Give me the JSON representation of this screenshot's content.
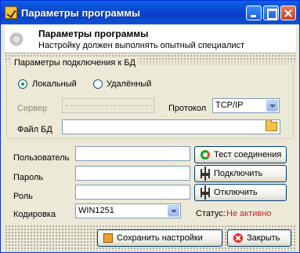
{
  "window": {
    "title": "Параметры программы"
  },
  "header": {
    "title": "Параметры программы",
    "subtitle": "Настройку должен выполнять опытный специалист"
  },
  "connection": {
    "group_title": "Параметры подключения к БД",
    "mode_local": "Локальный",
    "mode_remote": "Удалённый",
    "selected_mode": "Локальный",
    "server_label": "Сервер",
    "server_value": "",
    "protocol_label": "Протокол",
    "protocol_value": "TCP/IP",
    "db_file_label": "Файл БД",
    "db_file_value": ""
  },
  "auth": {
    "user_label": "Пользователь",
    "user_value": "",
    "password_label": "Пароль",
    "password_value": "",
    "role_label": "Роль",
    "role_value": "",
    "encoding_label": "Кодировка",
    "encoding_value": "WIN1251"
  },
  "actions": {
    "test_label": "Тест соединения",
    "connect_label": "Подключить",
    "disconnect_label": "Отключить"
  },
  "status": {
    "label": "Статус:",
    "value": "Не активно",
    "value_color": "#d21e1e"
  },
  "footer": {
    "save_label": "Сохранить настройки",
    "close_label": "Закрыть"
  },
  "icons": {
    "app": "settings-app-icon",
    "folder": "folder-open-icon",
    "test": "refresh-icon",
    "connect": "plug-icon",
    "disconnect": "unplug-icon",
    "save": "save-icon",
    "close": "close-circle-icon"
  }
}
